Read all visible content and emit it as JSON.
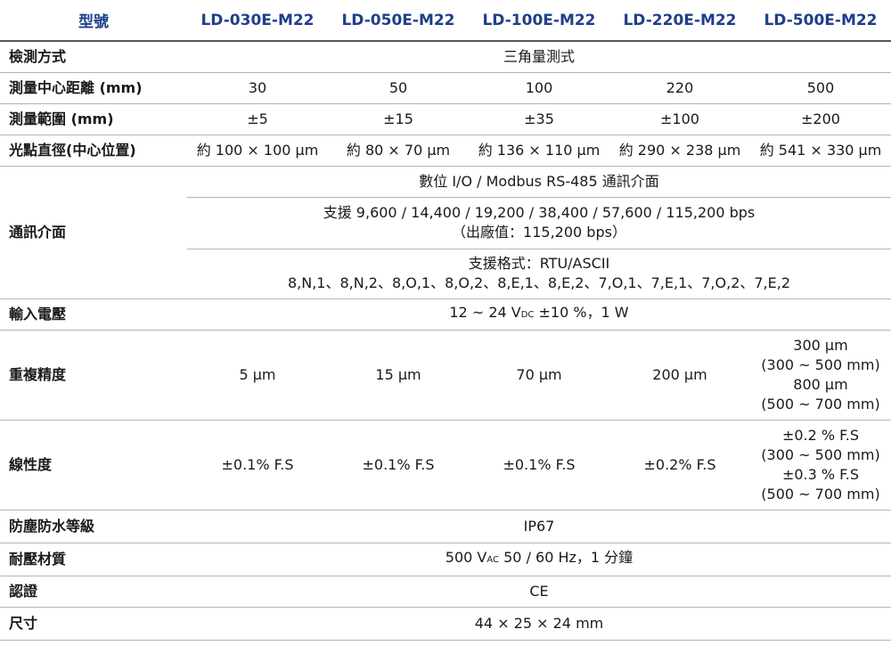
{
  "header": {
    "model_label": "型號",
    "models": [
      "LD-030E-M22",
      "LD-050E-M22",
      "LD-100E-M22",
      "LD-220E-M22",
      "LD-500E-M22"
    ]
  },
  "rows": {
    "method": {
      "label": "檢測方式",
      "value": "三角量測式"
    },
    "center_distance": {
      "label": "測量中心距離 (mm)",
      "values": [
        "30",
        "50",
        "100",
        "220",
        "500"
      ]
    },
    "range": {
      "label": "測量範圍 (mm)",
      "values": [
        "±5",
        "±15",
        "±35",
        "±100",
        "±200"
      ]
    },
    "spot": {
      "label": "光點直徑(中心位置)",
      "values": [
        "約 100 × 100 μm",
        "約 80 × 70 μm",
        "約 136 × 110 μm",
        "約 290 × 238 μm",
        "約 541 × 330 μm"
      ]
    },
    "comm": {
      "label": "通訊介面",
      "line1": "數位 I/O / Modbus RS-485 通訊介面",
      "baud_line1": "支援 9,600 / 14,400 / 19,200 / 38,400 / 57,600 / 115,200 bps",
      "baud_line2": "（出廠值：115,200 bps）",
      "format_line1": "支援格式：RTU/ASCII",
      "format_line2": "8,N,1、8,N,2、8,O,1、8,O,2、8,E,1、8,E,2、7,O,1、7,E,1、7,O,2、7,E,2"
    },
    "voltage": {
      "label": "輸入電壓",
      "prefix": "12 ~ 24 V",
      "sub": "DC",
      "suffix": " ±10 %，1 W"
    },
    "repeatability": {
      "label": "重複精度",
      "values": [
        "5 μm",
        "15 μm",
        "70 μm",
        "200 μm"
      ],
      "last_lines": [
        "300 μm",
        "(300 ~ 500 mm)",
        "800 μm",
        "(500 ~ 700 mm)"
      ]
    },
    "linearity": {
      "label": "線性度",
      "values": [
        "±0.1% F.S",
        "±0.1% F.S",
        "±0.1% F.S",
        "±0.2% F.S"
      ],
      "last_lines": [
        "±0.2 % F.S",
        "(300 ~ 500 mm)",
        "±0.3 % F.S",
        "(500 ~ 700 mm)"
      ]
    },
    "protection": {
      "label": "防塵防水等級",
      "value": "IP67"
    },
    "withstand": {
      "label": "耐壓材質",
      "prefix": "500 V",
      "sub": "AC",
      "suffix": " 50 / 60 Hz，1 分鐘"
    },
    "cert": {
      "label": "認證",
      "value": "CE"
    },
    "size": {
      "label": "尺寸",
      "value": "44 × 25 × 24 mm"
    }
  }
}
